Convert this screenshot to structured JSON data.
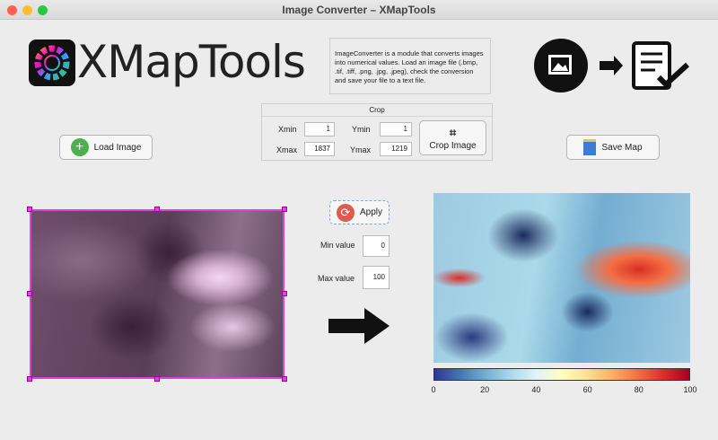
{
  "window": {
    "title": "Image Converter – XMapTools"
  },
  "logo": {
    "text": "XMapTools"
  },
  "description": "ImageConverter is a module that converts images into numerical values. Load an image file (.bmp, .tif, .tiff, .png, .jpg, .jpeg), check the conversion and save your file to a text file.",
  "crop": {
    "title": "Crop",
    "xmin_label": "Xmin",
    "xmin": "1",
    "ymin_label": "Ymin",
    "ymin": "1",
    "xmax_label": "Xmax",
    "xmax": "1837",
    "ymax_label": "Ymax",
    "ymax": "1219",
    "button": "Crop Image"
  },
  "buttons": {
    "load": "Load Image",
    "save": "Save Map",
    "apply": "Apply"
  },
  "params": {
    "min_label": "Min value",
    "min": "0",
    "max_label": "Max value",
    "max": "100"
  },
  "colorbar": {
    "ticks": [
      "0",
      "20",
      "40",
      "60",
      "80",
      "100"
    ],
    "min": 0,
    "max": 100
  }
}
